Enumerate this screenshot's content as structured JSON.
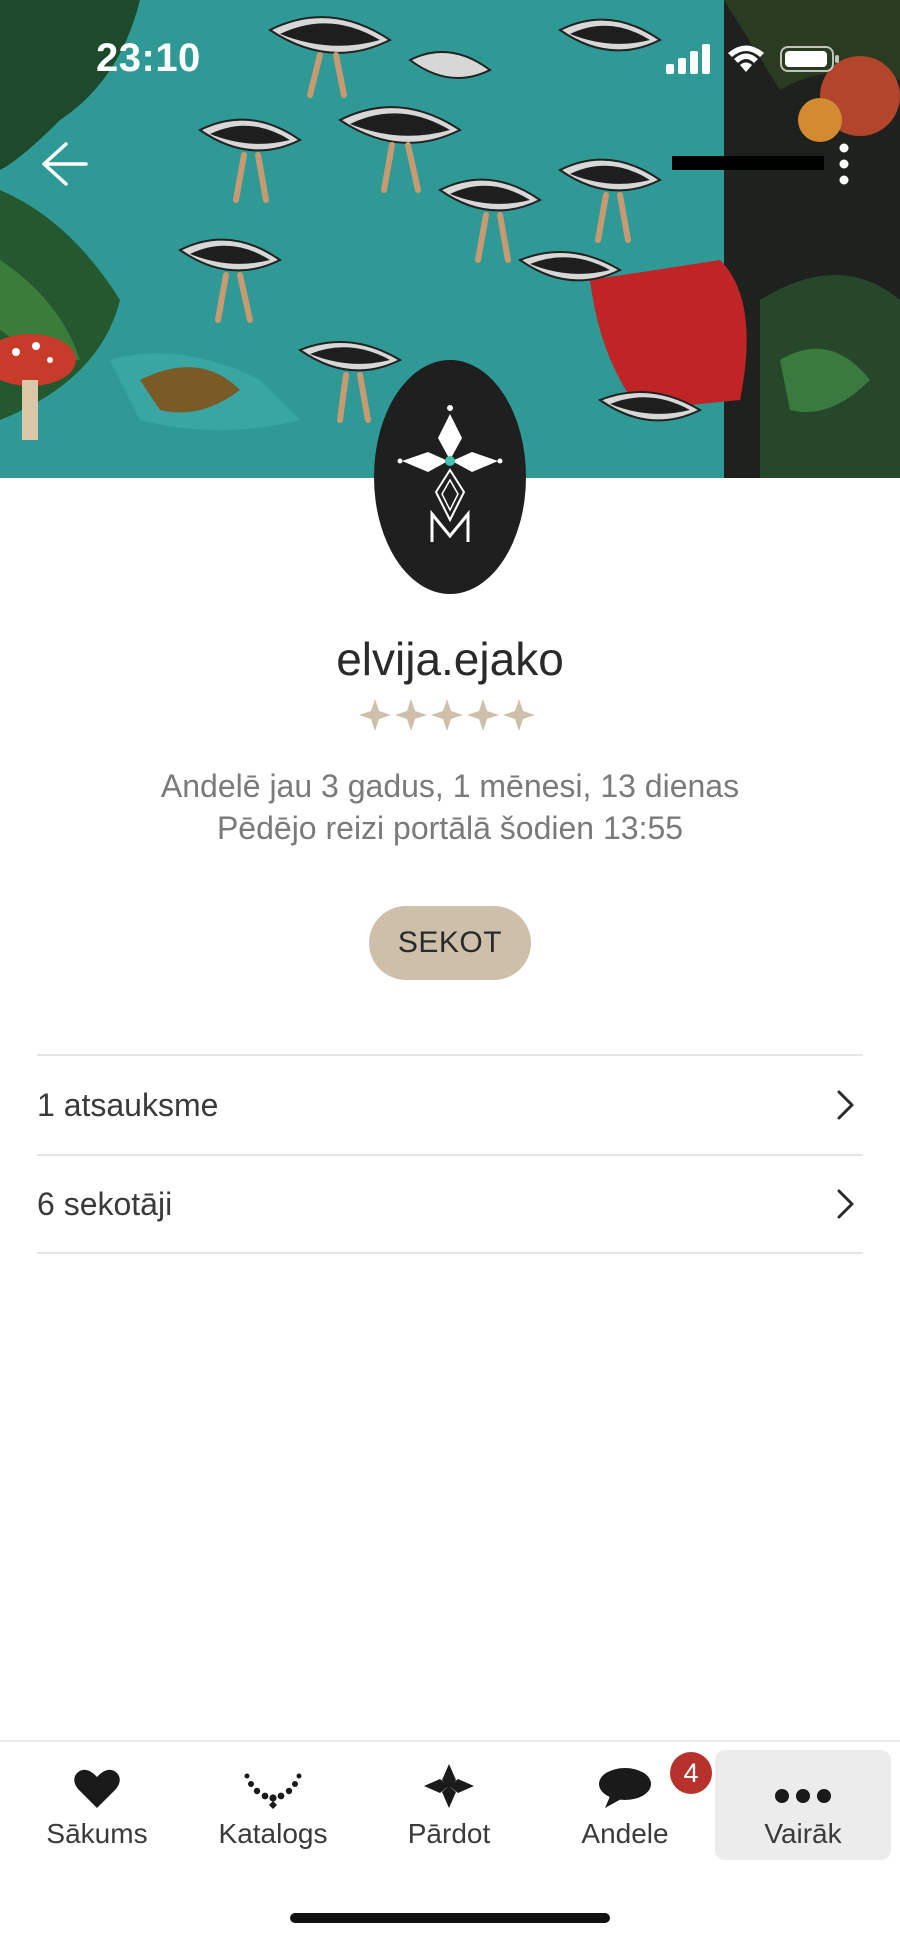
{
  "status_bar": {
    "time": "23:10"
  },
  "profile": {
    "username": "elvija.ejako",
    "rating_stars": 5,
    "member_since": "Andelē jau 3 gadus, 1 mēnesi, 13 dienas",
    "last_seen": "Pēdējo reizi portālā šodien 13:55",
    "follow_label": "SEKOT"
  },
  "list": [
    {
      "label": "1 atsauksme"
    },
    {
      "label": "6 sekotāji"
    }
  ],
  "tabbar": {
    "items": [
      {
        "label": "Sākums",
        "icon": "heart-icon"
      },
      {
        "label": "Katalogs",
        "icon": "necklace-icon"
      },
      {
        "label": "Pārdot",
        "icon": "diamond-cross-icon"
      },
      {
        "label": "Andele",
        "icon": "chat-bubble-icon"
      },
      {
        "label": "Vairāk",
        "icon": "more-dots-icon"
      }
    ],
    "active_index": 4,
    "andele_badge": "4"
  },
  "colors": {
    "accent_beige": "#cdbfa9",
    "badge_red": "#b7322c",
    "cover_teal": "#2f9a95"
  }
}
